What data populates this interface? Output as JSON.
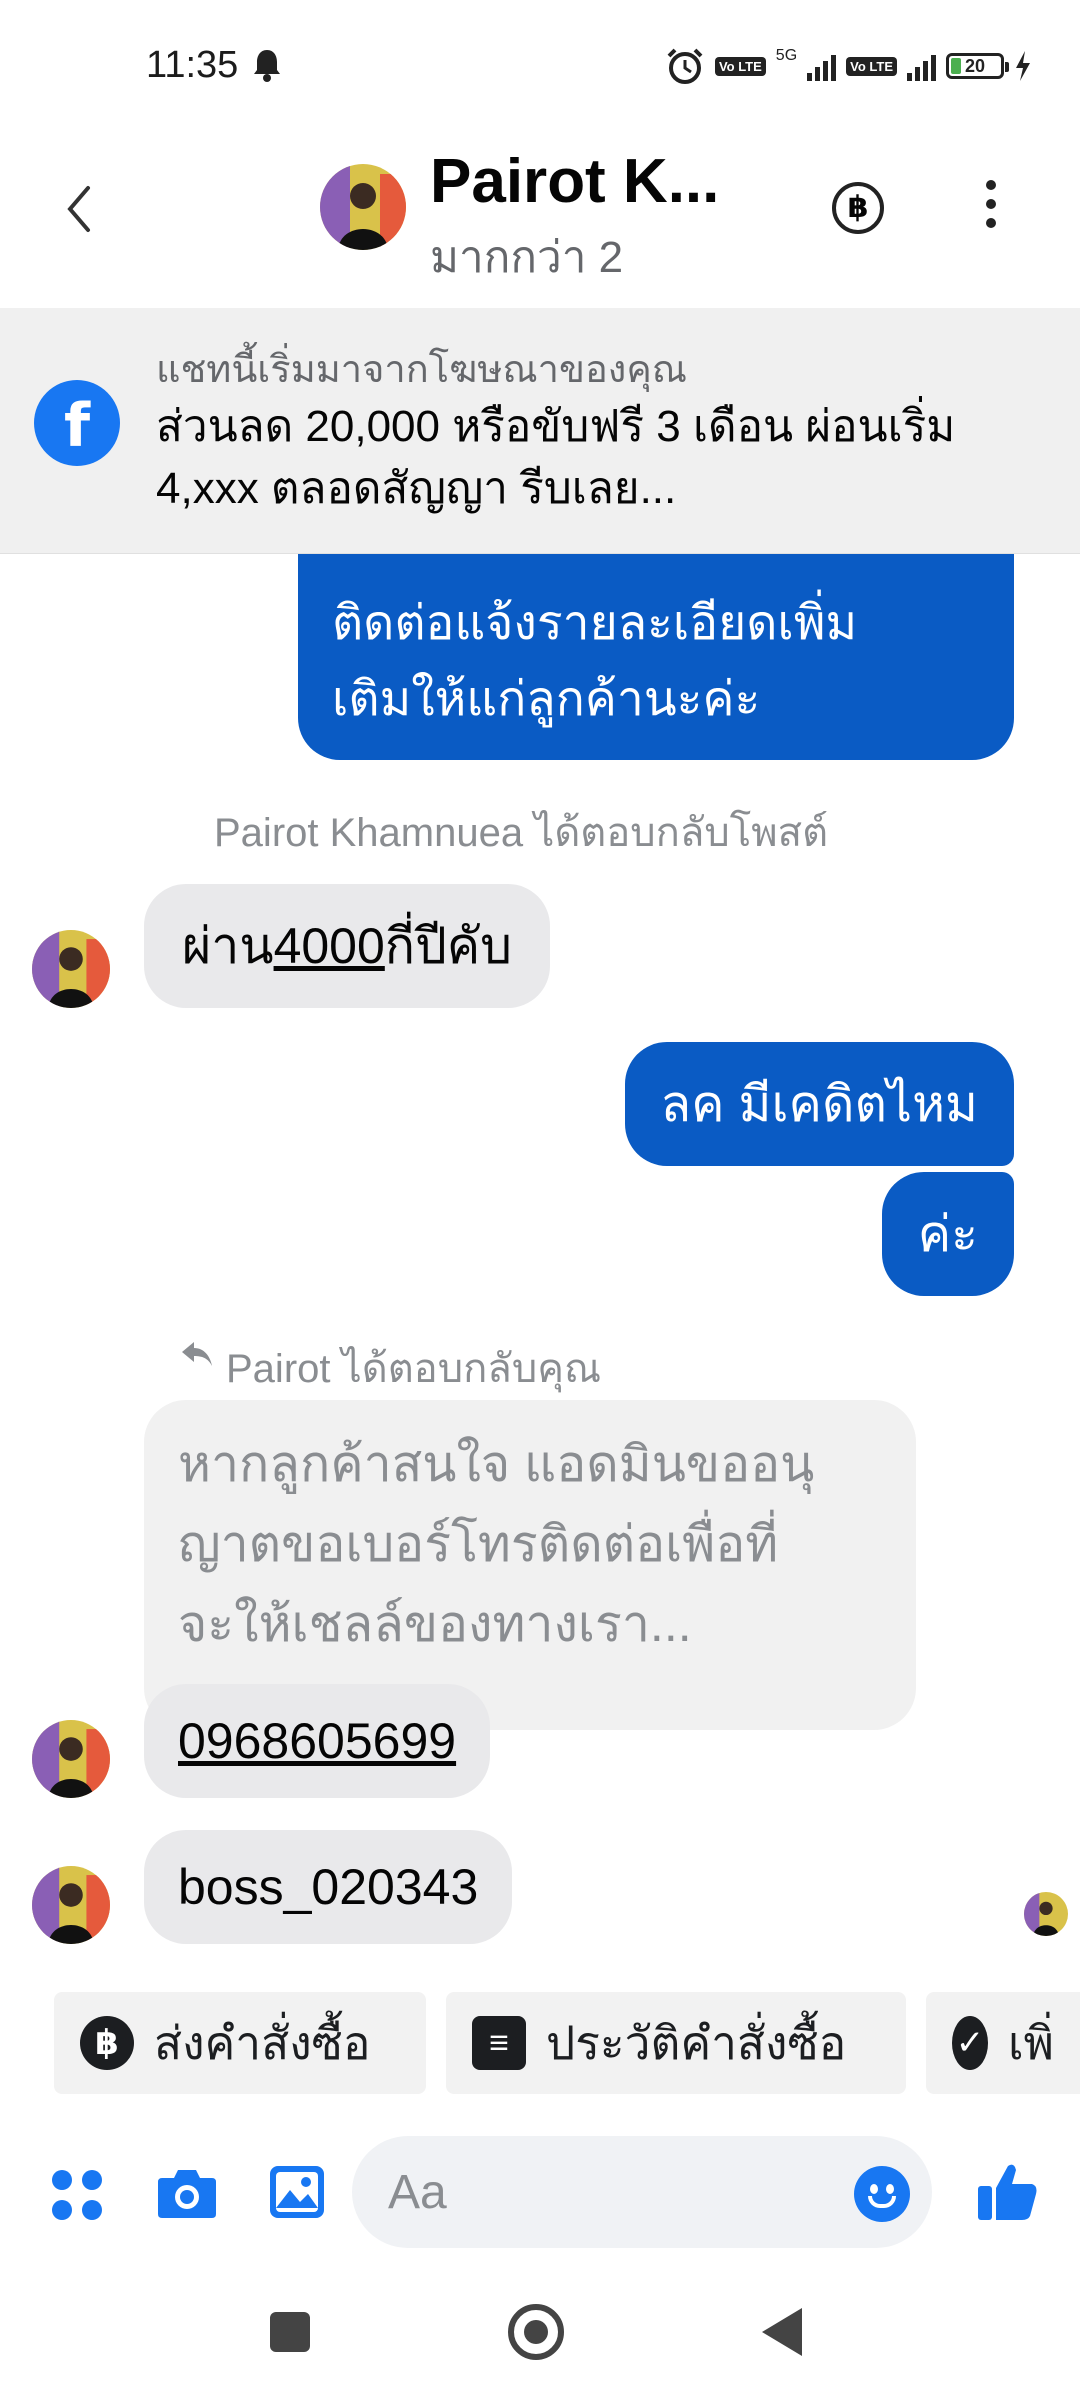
{
  "status_bar": {
    "time": "11:35",
    "network": "5G",
    "volte_1": "Vo LTE",
    "volte_2": "Vo LTE",
    "battery": "20"
  },
  "header": {
    "back_icon": "chevron-left-icon",
    "name": "Pairot K...",
    "subtitle": "มากกว่า 2",
    "payment_icon": "baht-circle-icon",
    "more_icon": "more-vertical-icon"
  },
  "ad_banner": {
    "icon": "facebook-icon",
    "source": "แชทนี้เริ่มมาจากโฆษณาของคุณ",
    "text": "ส่วนลด 20,000 หรือขับฟรี 3 เดือน ผ่อนเริ่ม 4,xxx ตลอดสัญญา รีบเลย..."
  },
  "messages": {
    "outgoing_partial": [
      "ติดต่อแจ้งรายละเอียดเพิ่ม",
      "เติมให้แก่ลูกค้านะค่ะ"
    ],
    "reply_notice": "Pairot Khamnuea ได้ตอบกลับโพสต์",
    "incoming_1_prefix": "ผ่าน",
    "incoming_1_link": "4000",
    "incoming_1_suffix": "กี่ปีคับ",
    "outgoing_1": "ลค มีเคดิตไหม",
    "outgoing_2": "ค่ะ",
    "reply_header": "Pairot ได้ตอบกลับคุณ",
    "quoted_lines": [
      "หากลูกค้าสนใจ แอดมินขออนุ",
      "ญาตขอเบอร์โทรติดต่อเพื่อที่",
      "จะให้เชลล์ของทางเรา..."
    ],
    "incoming_phone": "0968605699",
    "incoming_3": "boss_020343"
  },
  "quick_actions": [
    {
      "label": "ส่งคำสั่งซื้อ",
      "icon": "baht-circle-icon"
    },
    {
      "label": "ประวัติคำสั่งซื้อ",
      "icon": "list-document-icon"
    },
    {
      "label": "เพิ่",
      "icon": "check-circle-icon"
    }
  ],
  "composer": {
    "placeholder": "Aa",
    "menu_icon": "apps-icon",
    "camera_icon": "camera-icon",
    "gallery_icon": "image-icon",
    "emoji_icon": "emoji-icon",
    "like_icon": "thumbs-up-icon"
  },
  "colors": {
    "outgoing_bubble": "#0a5bc4",
    "incoming_bubble": "#e9e9eb",
    "accent": "#1877f2"
  }
}
